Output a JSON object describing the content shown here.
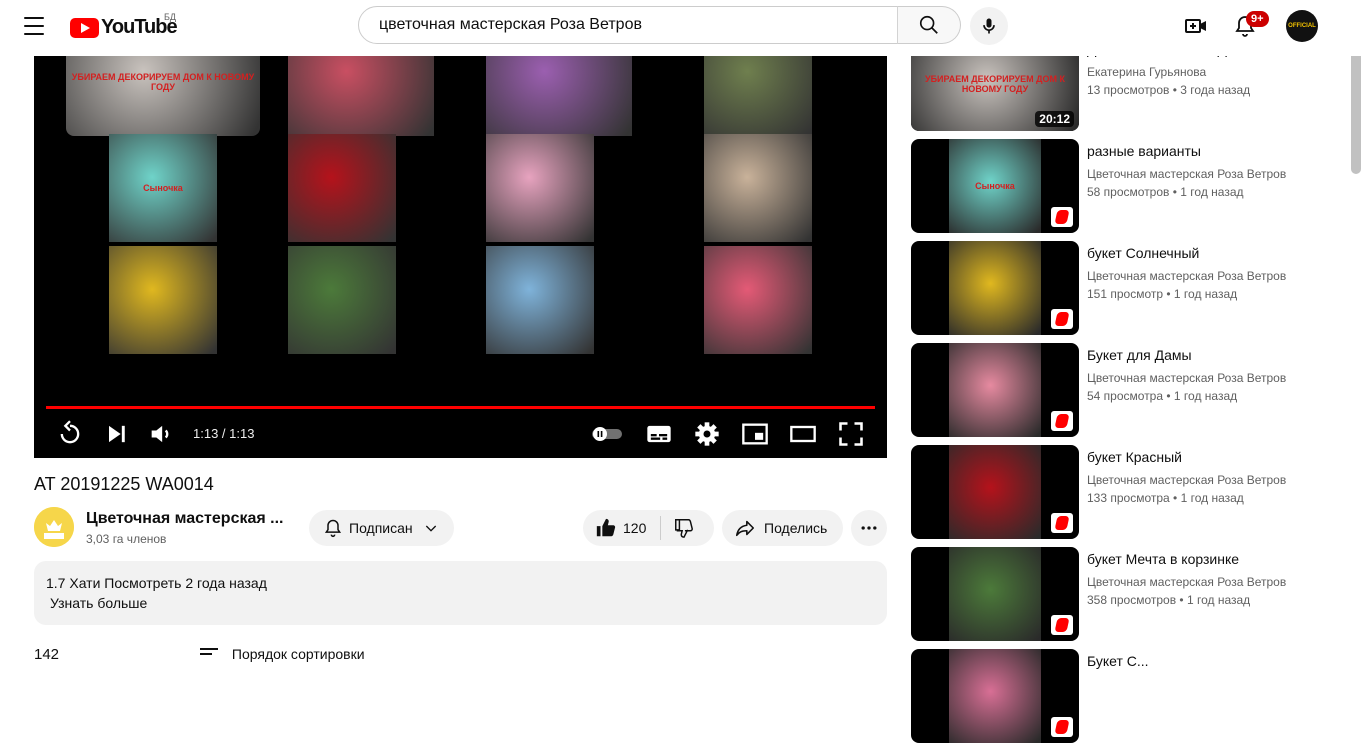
{
  "header": {
    "logo_text": "YouTube",
    "country_code": "БД",
    "search_value": "цветочная мастерская Роза Ветров",
    "notification_count": "9+",
    "avatar_text": "OFFICIAL"
  },
  "player": {
    "time": "1:13 / 1:13",
    "progress": 1.0,
    "tiles": [
      {
        "caption": "УБИРАЕМ ДЕКОРИРУЕМ ДОМ К НОВОМУ ГОДУ",
        "color": "#c9c3be"
      },
      {
        "caption": "",
        "color": "#c94f62"
      },
      {
        "caption": "",
        "color": "#9b5fb0"
      },
      {
        "caption": "",
        "color": "#6f7f4e"
      },
      {
        "caption": "Сыночка",
        "color": "#6fd3c9"
      },
      {
        "caption": "",
        "color": "#b5121b"
      },
      {
        "caption": "",
        "color": "#e7a3bf"
      },
      {
        "caption": "",
        "color": "#c9b29a"
      },
      {
        "caption": "",
        "color": "#e0b81f"
      },
      {
        "caption": "",
        "color": "#4c7a3a"
      },
      {
        "caption": "",
        "color": "#7fb3da"
      },
      {
        "caption": "",
        "color": "#e45a76"
      }
    ]
  },
  "video": {
    "title": "AT 20191225 WA0014",
    "channel_name": "Цветочная мастерская ...",
    "channel_subs": "3,03 га членов",
    "subscribe_label": "Подписан",
    "like_count": "120",
    "share_label": "Поделись",
    "description_line1": "1.7 Хати Посмотреть 2 года назад",
    "description_more": "Узнать больше",
    "comments_count": "142",
    "sort_label": "Порядок сортировки"
  },
  "sidebar": {
    "items": [
      {
        "title": "ДОМ К НОВОМУ ГОДУ/...",
        "channel": "Екатерина Гурьянова",
        "views": "13 просмотров",
        "age": "3 года назад",
        "duration": "20:12",
        "shorts": false,
        "thumb_color": "#c9c3be",
        "thumb_caption": "УБИРАЕМ ДЕКОРИРУЕМ ДОМ К НОВОМУ ГОДУ"
      },
      {
        "title": "разные варианты",
        "channel": "Цветочная мастерская Роза Ветров",
        "views": "58 просмотров",
        "age": "1 год назад",
        "duration": "",
        "shorts": true,
        "thumb_color": "#6fd3c9",
        "thumb_caption": "Сыночка"
      },
      {
        "title": "букет Солнечный",
        "channel": "Цветочная мастерская Роза Ветров",
        "views": "151 просмотр",
        "age": "1 год назад",
        "duration": "",
        "shorts": true,
        "thumb_color": "#e0b81f",
        "thumb_caption": ""
      },
      {
        "title": "Букет для Дамы",
        "channel": "Цветочная мастерская Роза Ветров",
        "views": "54 просмотра",
        "age": "1 год назад",
        "duration": "",
        "shorts": true,
        "thumb_color": "#e68aa0",
        "thumb_caption": ""
      },
      {
        "title": "букет Красный",
        "channel": "Цветочная мастерская Роза Ветров",
        "views": "133 просмотра",
        "age": "1 год назад",
        "duration": "",
        "shorts": true,
        "thumb_color": "#b5121b",
        "thumb_caption": ""
      },
      {
        "title": "букет Мечта в корзинке",
        "channel": "Цветочная мастерская Роза Ветров",
        "views": "358 просмотров",
        "age": "1 год назад",
        "duration": "",
        "shorts": true,
        "thumb_color": "#4c7a3a",
        "thumb_caption": ""
      },
      {
        "title": "Букет С...",
        "channel": "",
        "views": "",
        "age": "",
        "duration": "",
        "shorts": true,
        "thumb_color": "#d86f95",
        "thumb_caption": ""
      }
    ]
  },
  "colors": {
    "accent": "#ff0000",
    "text": "#0f0f0f",
    "muted": "#606060",
    "chip": "#f2f2f2"
  }
}
